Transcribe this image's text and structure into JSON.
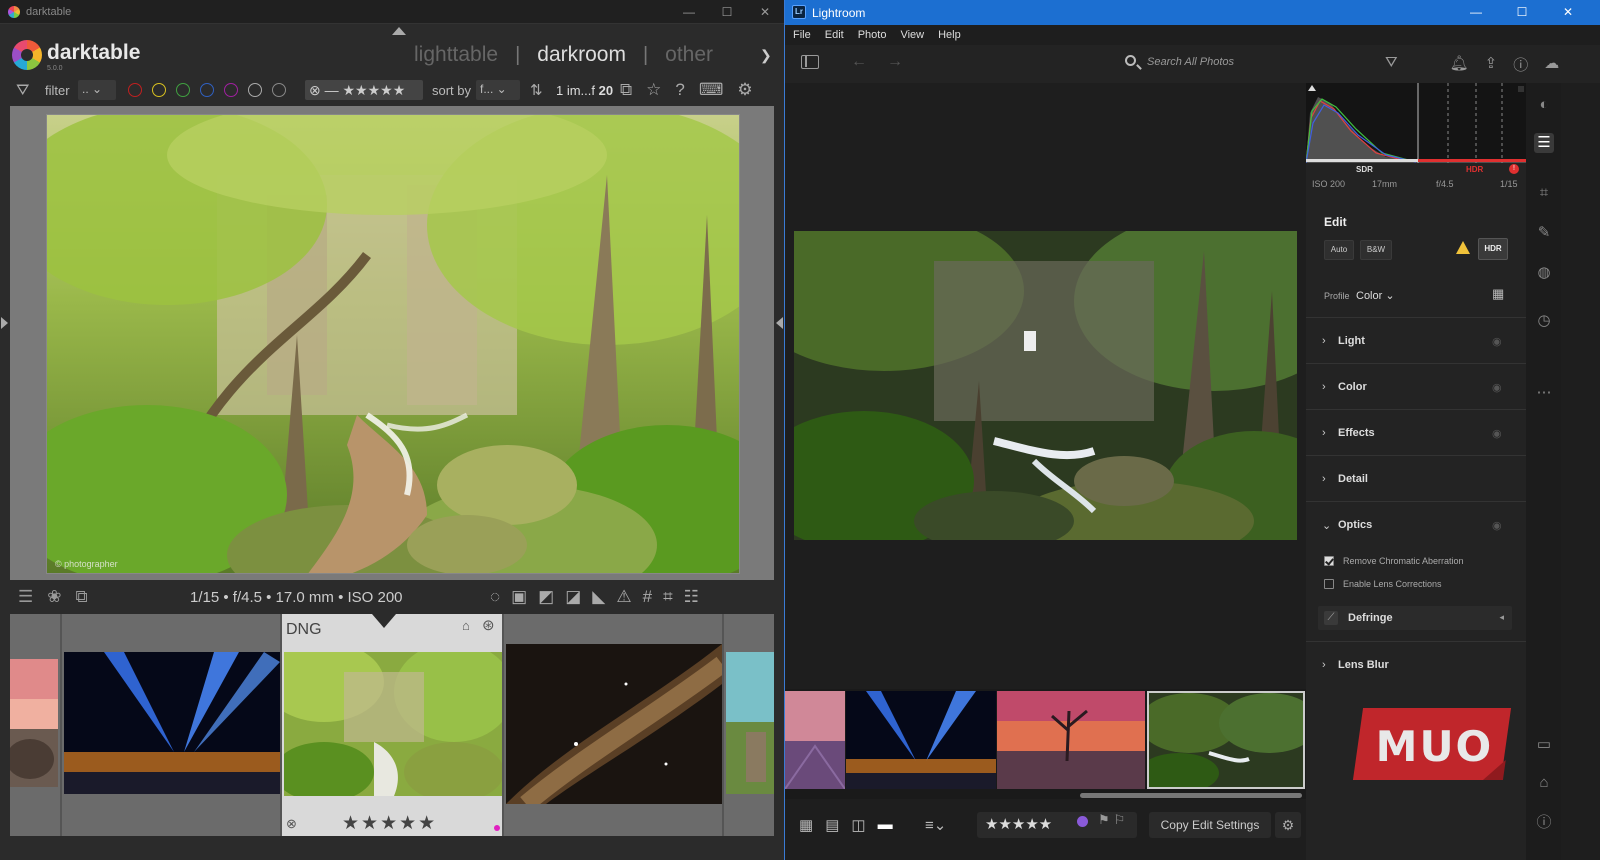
{
  "darktable": {
    "window_title": "darktable",
    "brand": "darktable",
    "version": "5.0.0",
    "views": [
      "lighttable",
      "darkroom",
      "other"
    ],
    "active_view": "darkroom",
    "filter_label": "filter",
    "filter_value": "..",
    "sort_label": "sort by",
    "sort_value": "f...",
    "count_prefix": "1 im...f",
    "count_total": "20",
    "rating_filter": "⊗ — ★★★★★",
    "exif": "1/15 • f/4.5 • 17.0 mm • ISO 200",
    "colors": {
      "label_dots": [
        "#c02020",
        "#d8c020",
        "#40a040",
        "#3060c0",
        "#a020a0",
        "#aaaaaa",
        "#888888"
      ]
    },
    "filmstrip": {
      "selected_format": "DNG",
      "selected_stars": "★★★★★"
    }
  },
  "lightroom": {
    "window_title": "Lightroom",
    "menu": [
      "File",
      "Edit",
      "Photo",
      "View",
      "Help"
    ],
    "search_placeholder": "Search All Photos",
    "histogram": {
      "sdr_label": "SDR",
      "hdr_label": "HDR",
      "iso": "ISO 200",
      "focal": "17mm",
      "aperture": "f/4.5",
      "shutter": "1/15"
    },
    "edit": {
      "title": "Edit",
      "auto_label": "Auto",
      "bw_label": "B&W",
      "hdr_label": "HDR",
      "profile_label": "Profile",
      "profile_value": "Color",
      "sections": [
        "Light",
        "Color",
        "Effects",
        "Detail",
        "Optics",
        "Lens Blur"
      ],
      "optics": {
        "remove_ca_label": "Remove Chromatic Aberration",
        "remove_ca_checked": true,
        "lens_corr_label": "Enable Lens Corrections",
        "lens_corr_checked": false,
        "defringe_label": "Defringe"
      }
    },
    "bottombar": {
      "copy_edit_label": "Copy Edit Settings",
      "stars": "★★★★★"
    },
    "watermark": "MUO"
  }
}
